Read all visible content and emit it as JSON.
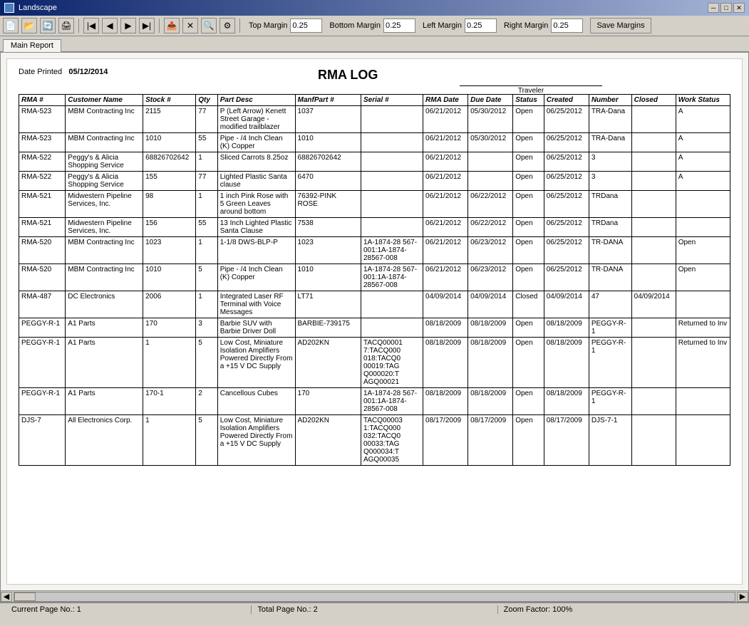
{
  "window": {
    "title": "Landscape"
  },
  "toolbar": {
    "top_margin_label": "Top Margin",
    "top_margin_value": "0.25",
    "bottom_margin_label": "Bottom Margin",
    "bottom_margin_value": "0.25",
    "left_margin_label": "Left Margin",
    "left_margin_value": "0.25",
    "right_margin_label": "Right Margin",
    "right_margin_value": "0.25",
    "save_margins_label": "Save Margins"
  },
  "tabs": [
    {
      "label": "Main Report",
      "active": true
    }
  ],
  "report": {
    "date_printed_label": "Date Printed",
    "date_printed_value": "05/12/2014",
    "title": "RMA LOG",
    "traveler_label": "Traveler",
    "columns": [
      "RMA #",
      "Customer Name",
      "Stock #",
      "Qty",
      "Part Desc",
      "ManfPart #",
      "Serial #",
      "RMA Date",
      "Due Date",
      "Status",
      "Created",
      "Number",
      "Closed",
      "Work Status"
    ],
    "rows": [
      {
        "rma": "RMA-523",
        "customer": "MBM Contracting Inc",
        "stock": "2115",
        "qty": "77",
        "part": "P (Left Arrow) Kenett Street Garage - modified trailblazer",
        "manf": "1037",
        "serial": "",
        "rma_date": "06/21/2012",
        "due_date": "05/30/2012",
        "status": "Open",
        "created": "06/25/2012",
        "number": "TRA-Dana",
        "closed": "",
        "work": "A"
      },
      {
        "rma": "RMA-523",
        "customer": "MBM Contracting Inc",
        "stock": "1010",
        "qty": "55",
        "part": "Pipe - /4 Inch Clean (K) Copper",
        "manf": "1010",
        "serial": "",
        "rma_date": "06/21/2012",
        "due_date": "05/30/2012",
        "status": "Open",
        "created": "06/25/2012",
        "number": "TRA-Dana",
        "closed": "",
        "work": "A"
      },
      {
        "rma": "RMA-522",
        "customer": "Peggy's & Alicia Shopping Service",
        "stock": "68826702642",
        "qty": "1",
        "part": "Sliced Carrots 8.25oz",
        "manf": "68826702642",
        "serial": "",
        "rma_date": "06/21/2012",
        "due_date": "",
        "status": "Open",
        "created": "06/25/2012",
        "number": "3",
        "closed": "",
        "work": "A"
      },
      {
        "rma": "RMA-522",
        "customer": "Peggy's & Alicia Shopping Service",
        "stock": "155",
        "qty": "77",
        "part": "Lighted Plastic Santa clause",
        "manf": "6470",
        "serial": "",
        "rma_date": "06/21/2012",
        "due_date": "",
        "status": "Open",
        "created": "06/25/2012",
        "number": "3",
        "closed": "",
        "work": "A"
      },
      {
        "rma": "RMA-521",
        "customer": "Midwestern Pipeline Services, Inc.",
        "stock": "98",
        "qty": "1",
        "part": "1 inch Pink Rose with 5 Green Leaves around bottom",
        "manf": "76392-PINK ROSE",
        "serial": "",
        "rma_date": "06/21/2012",
        "due_date": "06/22/2012",
        "status": "Open",
        "created": "06/25/2012",
        "number": "TRDana",
        "closed": "",
        "work": ""
      },
      {
        "rma": "RMA-521",
        "customer": "Midwestern Pipeline Services, Inc.",
        "stock": "156",
        "qty": "55",
        "part": "13 Inch Lighted Plastic Santa Clause",
        "manf": "7538",
        "serial": "",
        "rma_date": "06/21/2012",
        "due_date": "06/22/2012",
        "status": "Open",
        "created": "06/25/2012",
        "number": "TRDana",
        "closed": "",
        "work": ""
      },
      {
        "rma": "RMA-520",
        "customer": "MBM Contracting Inc",
        "stock": "1023",
        "qty": "1",
        "part": "1-1/8 DWS-BLP-P",
        "manf": "1023",
        "serial": "1A-1874-28 567-001:1A-1874-28567-008",
        "rma_date": "06/21/2012",
        "due_date": "06/23/2012",
        "status": "Open",
        "created": "06/25/2012",
        "number": "TR-DANA",
        "closed": "",
        "work": "Open"
      },
      {
        "rma": "RMA-520",
        "customer": "MBM Contracting Inc",
        "stock": "1010",
        "qty": "5",
        "part": "Pipe - /4 Inch Clean (K) Copper",
        "manf": "1010",
        "serial": "1A-1874-28 567-001:1A-1874-28567-008",
        "rma_date": "06/21/2012",
        "due_date": "06/23/2012",
        "status": "Open",
        "created": "06/25/2012",
        "number": "TR-DANA",
        "closed": "",
        "work": "Open"
      },
      {
        "rma": "RMA-487",
        "customer": "DC Electronics",
        "stock": "2006",
        "qty": "1",
        "part": "Integrated Laser RF Terminal with Voice Messages",
        "manf": "LT71",
        "serial": "",
        "rma_date": "04/09/2014",
        "due_date": "04/09/2014",
        "status": "Closed",
        "created": "04/09/2014",
        "number": "47",
        "closed": "04/09/2014",
        "work": ""
      },
      {
        "rma": "PEGGY-R-1",
        "customer": "A1 Parts",
        "stock": "170",
        "qty": "3",
        "part": "Barbie SUV with Barbie Driver Doll",
        "manf": "BARBIE-739175",
        "serial": "",
        "rma_date": "08/18/2009",
        "due_date": "08/18/2009",
        "status": "Open",
        "created": "08/18/2009",
        "number": "PEGGY-R-1",
        "closed": "",
        "work": "Returned to Inv"
      },
      {
        "rma": "PEGGY-R-1",
        "customer": "A1 Parts",
        "stock": "1",
        "qty": "5",
        "part": "Low Cost, Miniature Isolation Amplifiers Powered Directly From a +15 V DC Supply",
        "manf": "AD202KN",
        "serial": "TACQ00001 7:TACQ000 018:TACQ0 00019:TAG Q000020:T AGQ00021",
        "rma_date": "08/18/2009",
        "due_date": "08/18/2009",
        "status": "Open",
        "created": "08/18/2009",
        "number": "PEGGY-R-1",
        "closed": "",
        "work": "Returned to Inv"
      },
      {
        "rma": "PEGGY-R-1",
        "customer": "A1 Parts",
        "stock": "170-1",
        "qty": "2",
        "part": "Cancellous Cubes",
        "manf": "170",
        "serial": "1A-1874-28 567-001:1A-1874-28567-008",
        "rma_date": "08/18/2009",
        "due_date": "08/18/2009",
        "status": "Open",
        "created": "08/18/2009",
        "number": "PEGGY-R-1",
        "closed": "",
        "work": ""
      },
      {
        "rma": "DJS-7",
        "customer": "All Electronics Corp.",
        "stock": "1",
        "qty": "5",
        "part": "Low Cost, Miniature Isolation Amplifiers Powered Directly From a +15 V DC Supply",
        "manf": "AD202KN",
        "serial": "TACQ00003 1:TACQ000 032:TACQ0 00033:TAG Q000034:T AGQ00035",
        "rma_date": "08/17/2009",
        "due_date": "08/17/2009",
        "status": "Open",
        "created": "08/17/2009",
        "number": "DJS-7-1",
        "closed": "",
        "work": ""
      }
    ]
  },
  "status_bar": {
    "current_page_label": "Current Page No.:",
    "current_page_value": "1",
    "total_page_label": "Total Page No.:",
    "total_page_value": "2",
    "zoom_label": "Zoom Factor:",
    "zoom_value": "100%"
  }
}
